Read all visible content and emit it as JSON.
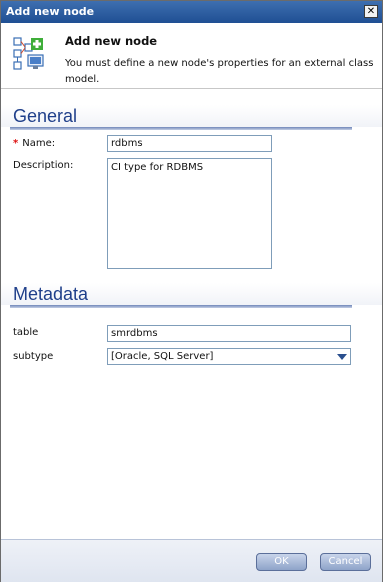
{
  "window": {
    "title": "Add new node",
    "close_glyph": "✕"
  },
  "header": {
    "icon": "class-model-icon",
    "title": "Add new node",
    "description": "You must define a new node's properties for an external class model."
  },
  "general": {
    "section_title": "General",
    "name_label": "Name:",
    "name_required_mark": "*",
    "name_value": "rdbms",
    "description_label": "Description:",
    "description_value": "CI type for RDBMS"
  },
  "metadata": {
    "section_title": "Metadata",
    "table_label": "table",
    "table_value": "smrdbms",
    "subtype_label": "subtype",
    "subtype_value": "[Oracle, SQL Server]"
  },
  "footer": {
    "ok_label": "OK",
    "cancel_label": "Cancel"
  },
  "colors": {
    "titlebar": "#2a5aa0",
    "section_title": "#1f3f8a",
    "required": "#dd1111"
  }
}
